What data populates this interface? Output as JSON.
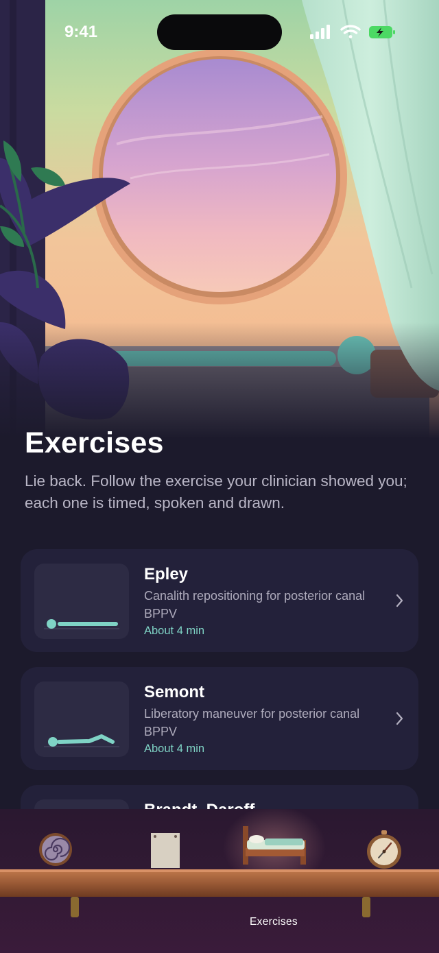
{
  "status_bar": {
    "time": "9:41"
  },
  "header": {
    "title": "Exercises",
    "subtitle": "Lie back. Follow the exercise your clinician showed you; each one is timed, spoken and drawn."
  },
  "exercises": [
    {
      "name": "Epley",
      "description": "Canalith repositioning for posterior canal BPPV",
      "duration": "About 4 min"
    },
    {
      "name": "Semont",
      "description": "Liberatory maneuver for posterior canal BPPV",
      "duration": "About 4 min"
    },
    {
      "name": "Brandt–Daroff",
      "description": "",
      "duration": ""
    }
  ],
  "tab_bar": {
    "active_label": "Exercises",
    "tabs": [
      {
        "icon": "spiral-icon"
      },
      {
        "icon": "paper-note-icon"
      },
      {
        "icon": "bed-icon"
      },
      {
        "icon": "compass-icon"
      }
    ]
  },
  "colors": {
    "background": "#1c1a2c",
    "card": "#23213a",
    "accent": "#7fd3c5"
  }
}
